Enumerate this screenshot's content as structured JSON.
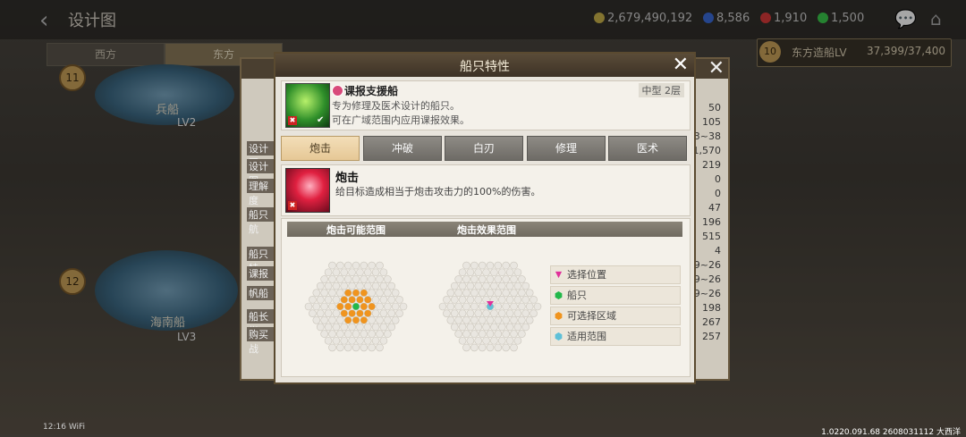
{
  "header": {
    "back_icon": "chevron-left-icon",
    "title": "设计图",
    "resources": [
      {
        "icon": "gold-coin-icon",
        "value": "2,679,490,192",
        "color": "#c9b24a"
      },
      {
        "icon": "blue-gem-icon",
        "value": "8,586",
        "color": "#3a6ad8"
      },
      {
        "icon": "red-gem-icon",
        "value": "1,910",
        "color": "#d83a3a"
      },
      {
        "icon": "green-leaf-icon",
        "value": "1,500",
        "color": "#3ac84a"
      }
    ]
  },
  "region_tabs": [
    "西方",
    "东方"
  ],
  "shipyard": {
    "level": "10",
    "label": "东方造船LV",
    "value": "37,399/37,400"
  },
  "ships": [
    {
      "level": "11",
      "name": "兵船",
      "lv": "LV2"
    },
    {
      "level": "12",
      "name": "海南船",
      "lv": "LV3"
    }
  ],
  "back_panel": {
    "left_labels": [
      "设计图",
      "设计图",
      "理解度",
      "船只航",
      "船只特",
      "课报",
      "帆船",
      "船长指",
      "购买战"
    ],
    "right_values": [
      "50",
      "105",
      "3~38",
      "1,570",
      "219",
      "0",
      "0",
      "47",
      "196",
      "515",
      "4",
      "9~26",
      "9~26",
      "9~26",
      "198",
      "267",
      "257"
    ]
  },
  "modal": {
    "title": "船只特性",
    "ship": {
      "name": "课报支援船",
      "size": "中型 2层",
      "desc_line1": "专为修理及医术设计的船只。",
      "desc_line2": "可在广域范围内应用课报效果。"
    },
    "tabs": [
      {
        "label": "炮击",
        "active": true
      },
      {
        "label": "冲破",
        "active": false
      },
      {
        "label": "白刃",
        "active": false
      },
      {
        "label": "修理",
        "active": false
      },
      {
        "label": "医术",
        "active": false
      }
    ],
    "skill": {
      "name": "炮击",
      "desc": "给目标造成相当于炮击攻击力的100%的伤害。"
    },
    "range": {
      "possible_label": "炮击可能范围",
      "effect_label": "炮击效果范围"
    },
    "legend": [
      {
        "label": "选择位置",
        "icon": "pink-triangle-icon",
        "color": "#e0309a"
      },
      {
        "label": "船只",
        "icon": "green-hexagon-icon",
        "color": "#22b84a"
      },
      {
        "label": "可选择区域",
        "icon": "orange-hexagon-icon",
        "color": "#f0941e"
      },
      {
        "label": "适用范围",
        "icon": "blue-hexagon-icon",
        "color": "#5ec0d8"
      }
    ]
  },
  "footer": {
    "time": "12:16",
    "status": "WiFi",
    "build": "1.0220.091.68 2608031112 大西洋"
  }
}
